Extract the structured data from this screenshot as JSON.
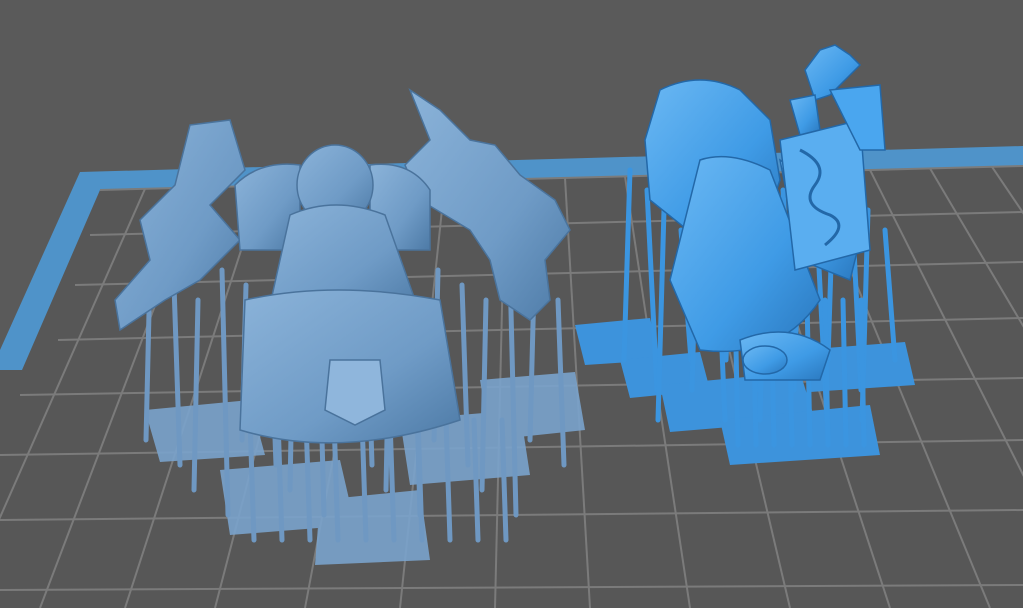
{
  "scene": {
    "background_color": "#5a5a5a",
    "build_plate": {
      "border_color": "#4f93c9",
      "grid_line_color": "#7b7b7b",
      "cell_color": "#575757"
    },
    "models": [
      {
        "id": "dwarf-warrior",
        "description_icon": "dwarf-miniature-with-axes",
        "state": "unselected",
        "color": "#6f9bc6",
        "support_color": "#7fa8d0"
      },
      {
        "id": "wizard-with-book",
        "description_icon": "wizard-miniature-with-book",
        "state": "selected",
        "color": "#3f9be6",
        "support_color": "#4aa6ef"
      }
    ]
  }
}
